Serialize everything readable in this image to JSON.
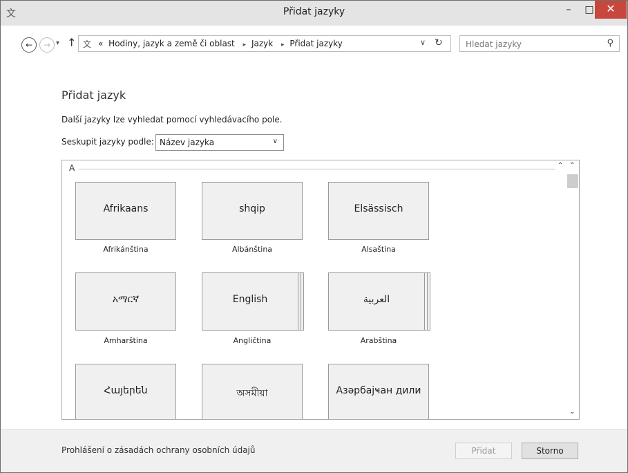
{
  "window": {
    "title": "Přidat jazyky"
  },
  "titlebar": {
    "min": "–",
    "max": "□",
    "close": "✕"
  },
  "nav": {
    "back": "←",
    "forward": "→",
    "recent": "▾",
    "up": "↑",
    "address": {
      "prefix": "«",
      "crumbs": [
        "Hodiny, jazyk a země či oblast",
        "Jazyk",
        "Přidat jazyky"
      ],
      "sep": "▸",
      "dropdown": "∨",
      "refresh": "↻"
    },
    "search": {
      "placeholder": "Hledat jazyky",
      "icon": "⚲"
    }
  },
  "main": {
    "title": "Přidat jazyk",
    "description": "Další jazyky lze vyhledat pomocí vyhledávacího pole.",
    "group_label": "Seskupit jazyky podle:",
    "group_value": "Název jazyka",
    "group_chevron": "∨"
  },
  "panel": {
    "section": "A",
    "collapse": "⌃",
    "scroll_up": "⌃",
    "scroll_down": "⌄",
    "tiles": [
      {
        "native": "Afrikaans",
        "caption": "Afrikánština"
      },
      {
        "native": "shqip",
        "caption": "Albánština"
      },
      {
        "native": "Elsässisch",
        "caption": "Alsaština"
      },
      {
        "native": "አማርኛ",
        "caption": "Amharština"
      },
      {
        "native": "English",
        "caption": "Angličtina"
      },
      {
        "native": "العربية",
        "caption": "Arabština"
      },
      {
        "native": "Հայերեն",
        "caption": ""
      },
      {
        "native": "অসমীয়া",
        "caption": ""
      },
      {
        "native": "Азәрбајҹан дили",
        "caption": ""
      }
    ]
  },
  "footer": {
    "privacy": "Prohlášení o zásadách ochrany osobních údajů",
    "add": "Přidat",
    "cancel": "Storno"
  }
}
